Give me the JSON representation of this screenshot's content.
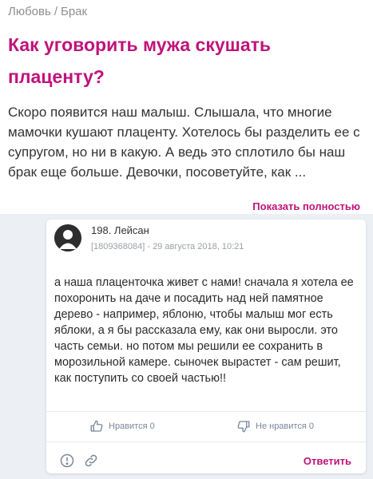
{
  "breadcrumb": {
    "item1": "Любовь",
    "separator": "/",
    "item2": "Брак"
  },
  "post": {
    "title": "Как уговорить мужа скушать плаценту?",
    "text": "Скоро появится наш малыш. Слышала, что многие мамочки кушают плаценту. Хотелось бы разделить ее с супругом, но ни в какую. А ведь это сплотило бы наш брак еще больше. Девочки, посоветуйте, как ...",
    "show_full_label": "Показать полностью"
  },
  "comment": {
    "author": "198. Лейсан",
    "meta": "[1809368084] - 29 августа 2018, 10:21",
    "text": "а наша плаценточка живет с нами! сначала я хотела ее похоронить на даче и посадить над ней памятное дерево - например, яблоню, чтобы малыш мог есть яблоки, а я бы рассказала ему, как они выросли. это часть семьи. но потом мы решили ее сохранить в морозильной камере. сыночек вырастет - сам решит, как поступить со своей частью!!",
    "like_label": "Нравится 0",
    "dislike_label": "Не нравится 0",
    "reply_label": "Ответить",
    "icons": {
      "avatar": "user-silhouette-icon",
      "report": "report-icon",
      "link": "link-icon",
      "like": "thumbs-up-icon",
      "dislike": "thumbs-down-icon"
    }
  },
  "colors": {
    "accent": "#c0137a",
    "text": "#333333",
    "muted": "#8f8f8f",
    "vote": "#7a8899",
    "background": "#eceff4"
  }
}
